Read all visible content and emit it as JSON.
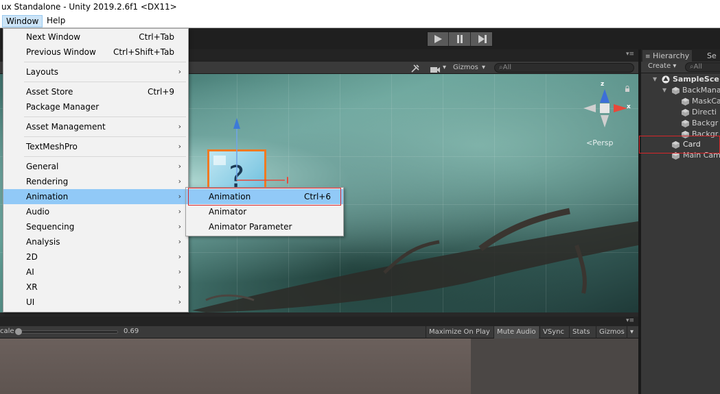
{
  "window_title": "ux Standalone - Unity 2019.2.6f1 <DX11>",
  "menubar": {
    "window": "Window",
    "help": "Help"
  },
  "playback": {
    "play_icon": "play-icon",
    "pause_icon": "pause-icon",
    "step_icon": "step-icon"
  },
  "scene_toolbar": {
    "gizmos_label": "Gizmos",
    "search_placeholder": "All"
  },
  "scene_gizmo": {
    "x_label": "x",
    "z_label": "z",
    "persp_label": "Persp"
  },
  "game_toolbar": {
    "scale_label": "cale",
    "scale_value": "0.69",
    "maximize_on_play": "Maximize On Play",
    "mute_audio": "Mute Audio",
    "vsync": "VSync",
    "stats": "Stats",
    "gizmos": "Gizmos"
  },
  "hierarchy": {
    "tab_label": "Hierarchy",
    "tab2_label": "Se",
    "create_label": "Create",
    "search_placeholder": "All",
    "items": [
      {
        "label": "SampleSce",
        "kind": "scene"
      },
      {
        "label": "BackMana",
        "kind": "object"
      },
      {
        "label": "MaskCa",
        "kind": "object"
      },
      {
        "label": "Directi",
        "kind": "object"
      },
      {
        "label": "Backgr",
        "kind": "object"
      },
      {
        "label": "Backgr",
        "kind": "object"
      },
      {
        "label": "Card",
        "kind": "object"
      },
      {
        "label": "Main Cam",
        "kind": "object"
      }
    ]
  },
  "window_menu": {
    "items": [
      {
        "label": "Next Window",
        "shortcut": "Ctrl+Tab"
      },
      {
        "label": "Previous Window",
        "shortcut": "Ctrl+Shift+Tab"
      },
      {
        "label": "Layouts",
        "shortcut": ""
      },
      {
        "label": "Asset Store",
        "shortcut": "Ctrl+9"
      },
      {
        "label": "Package Manager",
        "shortcut": ""
      },
      {
        "label": "Asset Management",
        "shortcut": ""
      },
      {
        "label": "TextMeshPro",
        "shortcut": ""
      },
      {
        "label": "General",
        "shortcut": ""
      },
      {
        "label": "Rendering",
        "shortcut": ""
      },
      {
        "label": "Animation",
        "shortcut": ""
      },
      {
        "label": "Audio",
        "shortcut": ""
      },
      {
        "label": "Sequencing",
        "shortcut": ""
      },
      {
        "label": "Analysis",
        "shortcut": ""
      },
      {
        "label": "2D",
        "shortcut": ""
      },
      {
        "label": "AI",
        "shortcut": ""
      },
      {
        "label": "XR",
        "shortcut": ""
      },
      {
        "label": "UI",
        "shortcut": ""
      }
    ],
    "submenu_arrow": "›"
  },
  "animation_submenu": {
    "items": [
      {
        "label": "Animation",
        "shortcut": "Ctrl+6"
      },
      {
        "label": "Animator",
        "shortcut": ""
      },
      {
        "label": "Animator Parameter",
        "shortcut": ""
      }
    ]
  },
  "colors": {
    "highlight": "#91c9f7",
    "annotation_red": "#d8262a",
    "menu_bg": "#f2f2f2"
  }
}
